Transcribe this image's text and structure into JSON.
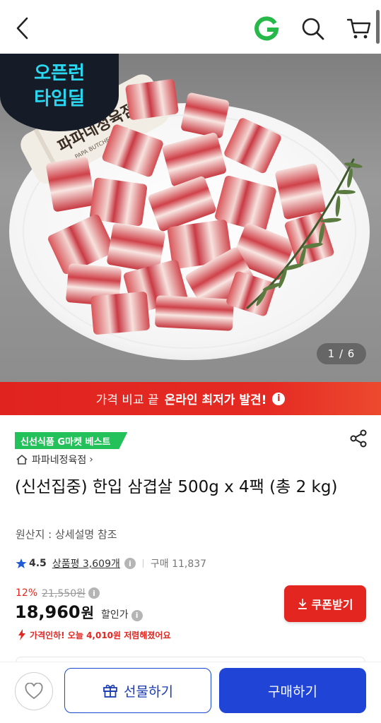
{
  "header": {
    "back_icon": "chevron-left-icon",
    "logo_letter": "G",
    "search_icon": "search-icon",
    "cart_icon": "cart-icon"
  },
  "hero": {
    "promo_badge_line1": "오픈런",
    "promo_badge_line2": "타임딜",
    "package_label": "파파네정육점",
    "package_label_en": "PAPA BUTCHER SHOP",
    "page_counter": "1 / 6"
  },
  "price_banner": {
    "text_normal": "가격 비교 끝",
    "text_strong": "온라인 최저가 발견!",
    "info_glyph": "i"
  },
  "product": {
    "badge": "신선식품 G마켓 베스트",
    "store": "파파네정육점",
    "store_chevron": "›",
    "title": "(신선집중) 한입 삼겹살 500g x 4팩 (총 2 kg)",
    "origin": "원산지 : 상세설명 참조",
    "rating": "4.5",
    "reviews": "상품평 3,609개",
    "sold": "구매 11,837"
  },
  "pricing": {
    "discount_pct": "12%",
    "original_price": "21,550",
    "original_unit": "원",
    "price": "18,960",
    "price_unit": "원",
    "price_label": "할인가",
    "coupon_label": "쿠폰받기",
    "price_drop_text": "가격인하! 오늘 4,010원 저렴해졌어요"
  },
  "bottom_bar": {
    "wish_icon": "heart-icon",
    "gift_label": "선물하기",
    "buy_label": "구매하기"
  },
  "colors": {
    "accent_red": "#e3261f",
    "accent_blue": "#1f44d6",
    "badge_green": "#23c15a",
    "logo_green": "#27b84a"
  }
}
